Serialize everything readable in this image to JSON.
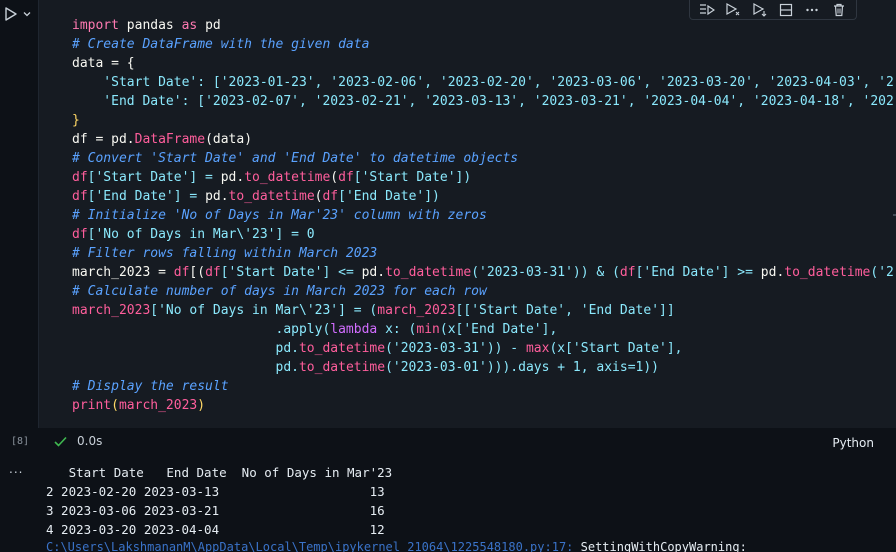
{
  "cell": {
    "code_lines": [
      [
        {
          "t": "import",
          "c": "kw"
        },
        {
          "t": " pandas ",
          "c": "id"
        },
        {
          "t": "as",
          "c": "kw"
        },
        {
          "t": " pd",
          "c": "id"
        }
      ],
      [
        {
          "t": "# Create DataFrame with the given data",
          "c": "cm"
        }
      ],
      [
        {
          "t": "data = {",
          "c": "id"
        }
      ],
      [
        {
          "t": "    'Start Date': [",
          "c": "st"
        },
        {
          "t": "'2023-01-23', '2023-02-06', '2023-02-20', '2023-03-06', '2023-03-20', '2023-04-03', '2",
          "c": "st"
        }
      ],
      [
        {
          "t": "    'End Date': [",
          "c": "st"
        },
        {
          "t": "'2023-02-07', '2023-02-21', '2023-03-13', '2023-03-21', '2023-04-04', '2023-04-18', '202",
          "c": "st"
        }
      ],
      [
        {
          "t": "}",
          "c": "br"
        }
      ],
      [
        {
          "t": "df = pd.",
          "c": "id"
        },
        {
          "t": "DataFrame",
          "c": "fn"
        },
        {
          "t": "(data)",
          "c": "id"
        }
      ],
      [
        {
          "t": "# Convert 'Start Date' and 'End Date' to datetime objects",
          "c": "cm"
        }
      ],
      [
        {
          "t": "df",
          "c": "fn"
        },
        {
          "t": "['Start Date'] = ",
          "c": "st"
        },
        {
          "t": "pd.",
          "c": "id"
        },
        {
          "t": "to_datetime",
          "c": "fn"
        },
        {
          "t": "(",
          "c": "id"
        },
        {
          "t": "df",
          "c": "fn"
        },
        {
          "t": "['Start Date'])",
          "c": "st"
        }
      ],
      [
        {
          "t": "df",
          "c": "fn"
        },
        {
          "t": "['End Date'] = ",
          "c": "st"
        },
        {
          "t": "pd.",
          "c": "id"
        },
        {
          "t": "to_datetime",
          "c": "fn"
        },
        {
          "t": "(",
          "c": "id"
        },
        {
          "t": "df",
          "c": "fn"
        },
        {
          "t": "['End Date'])",
          "c": "st"
        }
      ],
      [
        {
          "t": "# Initialize 'No of Days in Mar'23' column with zeros",
          "c": "cm"
        }
      ],
      [
        {
          "t": "df",
          "c": "fn"
        },
        {
          "t": "['No of Days in Mar\\'23'] = 0",
          "c": "st"
        }
      ],
      [
        {
          "t": "# Filter rows falling within March 2023",
          "c": "cm"
        }
      ],
      [
        {
          "t": "march_2023 = ",
          "c": "id"
        },
        {
          "t": "df",
          "c": "fn"
        },
        {
          "t": "[(",
          "c": "id"
        },
        {
          "t": "df",
          "c": "fn"
        },
        {
          "t": "['Start Date'] <= ",
          "c": "st"
        },
        {
          "t": "pd.",
          "c": "id"
        },
        {
          "t": "to_datetime",
          "c": "fn"
        },
        {
          "t": "('2023-03-31')) & (",
          "c": "st"
        },
        {
          "t": "df",
          "c": "fn"
        },
        {
          "t": "['End Date'] >= ",
          "c": "st"
        },
        {
          "t": "pd.",
          "c": "id"
        },
        {
          "t": "to_datetime",
          "c": "fn"
        },
        {
          "t": "('2",
          "c": "st"
        }
      ],
      [
        {
          "t": "# Calculate number of days in March 2023 for each row",
          "c": "cm"
        }
      ],
      [
        {
          "t": "march_2023",
          "c": "fn"
        },
        {
          "t": "['No of Days in Mar\\'23'] = (",
          "c": "st"
        },
        {
          "t": "march_2023",
          "c": "fn"
        },
        {
          "t": "[['Start Date', 'End Date']]",
          "c": "st"
        }
      ],
      [
        {
          "t": "                          .apply(",
          "c": "st"
        },
        {
          "t": "lambda",
          "c": "kw2"
        },
        {
          "t": " x: (",
          "c": "st"
        },
        {
          "t": "min",
          "c": "fn"
        },
        {
          "t": "(x['End Date'],",
          "c": "st"
        }
      ],
      [
        {
          "t": "                          pd.",
          "c": "st"
        },
        {
          "t": "to_datetime",
          "c": "fn"
        },
        {
          "t": "('2023-03-31')) - ",
          "c": "st"
        },
        {
          "t": "max",
          "c": "fn"
        },
        {
          "t": "(x['Start Date'],",
          "c": "st"
        }
      ],
      [
        {
          "t": "                          pd.",
          "c": "st"
        },
        {
          "t": "to_datetime",
          "c": "fn"
        },
        {
          "t": "('2023-03-01'))).days + 1, axis=1))",
          "c": "st"
        }
      ],
      [
        {
          "t": "# Display the result",
          "c": "cm"
        }
      ],
      [
        {
          "t": "print",
          "c": "fn"
        },
        {
          "t": "(",
          "c": "br"
        },
        {
          "t": "march_2023",
          "c": "fn"
        },
        {
          "t": ")",
          "c": "br"
        }
      ]
    ],
    "exec_count": "[8]",
    "status_time": "0.0s",
    "language": "Python"
  },
  "output": {
    "dots": "...",
    "header": "   Start Date   End Date  No of Days in Mar'23",
    "rows": [
      "2 2023-02-20 2023-03-13                    13",
      "3 2023-03-06 2023-03-21                    16",
      "4 2023-03-20 2023-04-04                    12"
    ],
    "warning_path": "C:\\Users\\LakshmananM\\AppData\\Local\\Temp\\ipykernel_21064\\1225548180.py:17: ",
    "warning_type": "SettingWithCopyWarning:"
  },
  "colors": {
    "background": "#0d1117",
    "cell_background": "#161b22",
    "keyword": "#ff7ab2",
    "comment": "#5aa2ff",
    "string": "#8be9fd",
    "function": "#ff5e9c",
    "success": "#3fb950"
  }
}
